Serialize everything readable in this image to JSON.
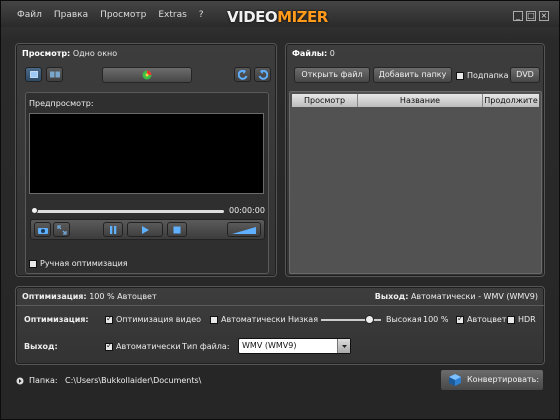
{
  "menu": [
    "Файл",
    "Правка",
    "Просмотр",
    "Extras",
    "?"
  ],
  "logo": {
    "part1": "VIDEO",
    "part2": "MIZER"
  },
  "window_controls": {
    "minimize": "_",
    "maximize": "□",
    "close": "×"
  },
  "preview": {
    "title_label": "Просмотр:",
    "title_value": "Одно окно",
    "inner_label": "Предпросмотр:",
    "time": "00:00:00",
    "manual_opt_label": "Ручная оптимизация"
  },
  "files": {
    "title_label": "Файлы:",
    "count": "0",
    "open_file": "Открыть файл",
    "add_folder": "Добавить папку",
    "subfolder_label": "Подпапка",
    "dvd": "DVD",
    "columns": [
      "Просмотр",
      "Название",
      "Продолжите"
    ]
  },
  "optimization": {
    "summary_label": "Оптимизация:",
    "summary_value": "100 % Автоцвет",
    "output_label": "Выход:",
    "output_value": "Автоматически - WMV (WMV9)",
    "row_label": "Оптимизация:",
    "video_opt": "Оптимизация видео",
    "auto": "Автоматически",
    "low": "Низкая",
    "high": "Высокая",
    "percent_value": "100",
    "percent_unit": "%",
    "autocolor": "Автоцвет",
    "hdr": "HDR",
    "slider_level": 0.8,
    "out_row_label": "Выход:",
    "out_auto": "Автоматически",
    "file_type_label": "Тип файла:",
    "file_type_value": "WMV (WMV9)"
  },
  "footer": {
    "folder_label": "Папка:",
    "folder_path": "C:\\Users\\Bukkollaider\\Documents\\",
    "convert": "Конвертировать:"
  },
  "colors": {
    "accent": "#ff9a1a",
    "icon_blue": "#4a9fe8"
  }
}
